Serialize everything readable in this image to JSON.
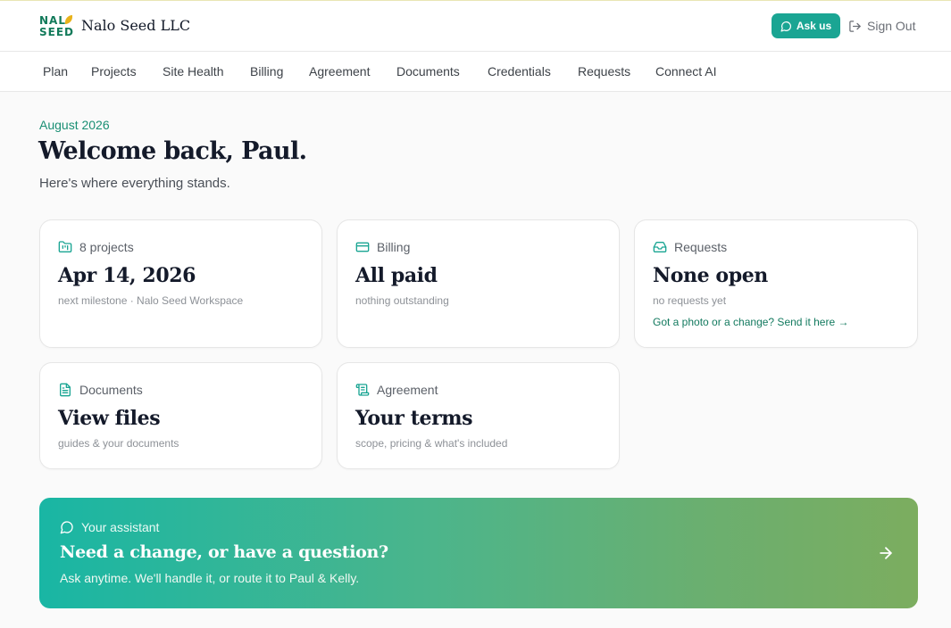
{
  "brand": {
    "logo_line1": "NAL",
    "logo_line2": "SEED",
    "company": "Nalo Seed LLC",
    "colors": {
      "accent": "#1aa593",
      "brand_green": "#127a5a",
      "leaf": "#e8b21a"
    }
  },
  "header": {
    "ask_label": "Ask us",
    "ask_icon": "chat-bubble-icon",
    "signout_label": "Sign Out",
    "signout_icon": "sign-out-icon"
  },
  "nav": {
    "items": [
      "Plan",
      "Projects",
      "Site Health",
      "Billing",
      "Agreement",
      "Documents",
      "Credentials",
      "Requests",
      "Connect AI"
    ]
  },
  "hero": {
    "month": "August 2026",
    "title": "Welcome back, Paul.",
    "subtitle": "Here's where everything stands."
  },
  "cards": [
    {
      "icon": "folder-kanban-icon",
      "label": "8 projects",
      "value": "Apr 14, 2026",
      "note": "next milestone · Nalo Seed Workspace"
    },
    {
      "icon": "credit-card-icon",
      "label": "Billing",
      "value": "All paid",
      "note": "nothing outstanding"
    },
    {
      "icon": "inbox-icon",
      "label": "Requests",
      "value": "None open",
      "note": "no requests yet",
      "link": "Got a photo or a change? Send it here →"
    },
    {
      "icon": "document-icon",
      "label": "Documents",
      "value": "View files",
      "note": "guides & your documents"
    },
    {
      "icon": "scroll-icon",
      "label": "Agreement",
      "value": "Your terms",
      "note": "scope, pricing & what's included"
    }
  ],
  "assistant": {
    "icon": "chat-bubble-icon",
    "label": "Your assistant",
    "title": "Need a change, or have a question?",
    "desc": "Ask anytime. We'll handle it, or route it to Paul & Kelly.",
    "arrow_icon": "arrow-right-icon",
    "gradient_start": "#19b6a4",
    "gradient_end": "#7cad5f"
  }
}
